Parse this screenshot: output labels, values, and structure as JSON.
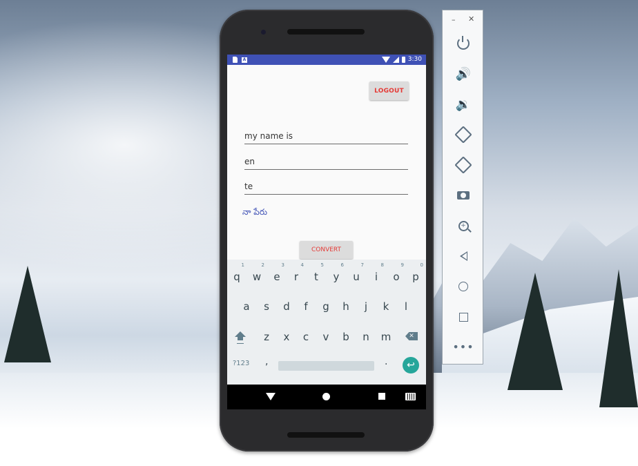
{
  "status_bar": {
    "time": "3:30",
    "sd_icon": "sd-card-icon",
    "a_icon": "A"
  },
  "app": {
    "logout_label": "LOGOUT",
    "input_text": "my name is",
    "source_lang": "en",
    "target_lang": "te",
    "result_text": "నా పేరు",
    "convert_label": "CONVERT"
  },
  "keyboard": {
    "row1": [
      {
        "key": "q",
        "hint": "1"
      },
      {
        "key": "w",
        "hint": "2"
      },
      {
        "key": "e",
        "hint": "3"
      },
      {
        "key": "r",
        "hint": "4"
      },
      {
        "key": "t",
        "hint": "5"
      },
      {
        "key": "y",
        "hint": "6"
      },
      {
        "key": "u",
        "hint": "7"
      },
      {
        "key": "i",
        "hint": "8"
      },
      {
        "key": "o",
        "hint": "9"
      },
      {
        "key": "p",
        "hint": "0"
      }
    ],
    "row2": [
      "a",
      "s",
      "d",
      "f",
      "g",
      "h",
      "j",
      "k",
      "l"
    ],
    "row3": [
      "z",
      "x",
      "c",
      "v",
      "b",
      "n",
      "m"
    ],
    "symbols_label": "?123",
    "comma": ",",
    "period": ".",
    "enter_icon": "↩",
    "backspace_icon": "✕"
  },
  "navigation": {
    "icons": [
      "back-icon",
      "home-icon",
      "recent-apps-icon",
      "keyboard-icon"
    ]
  },
  "emulator_sidebar": {
    "minimize": "–",
    "close": "✕",
    "zoom_plus": "+",
    "more": "•••",
    "buttons": [
      "power",
      "volume-up",
      "volume-down",
      "rotate-left",
      "rotate-right",
      "screenshot",
      "zoom",
      "back",
      "home",
      "overview",
      "more"
    ]
  },
  "colors": {
    "primary": "#3f51b5",
    "accent_red": "#e53935",
    "enter_teal": "#26a69a",
    "sidebar_icon": "#5c6f80"
  }
}
